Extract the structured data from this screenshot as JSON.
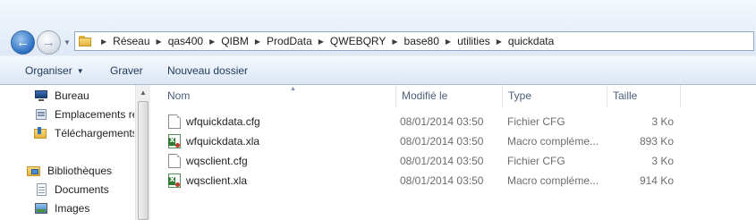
{
  "address_bar": {
    "breadcrumbs": [
      "Réseau",
      "qas400",
      "QIBM",
      "ProdData",
      "QWEBQRY",
      "base80",
      "utilities",
      "quickdata"
    ]
  },
  "toolbar": {
    "organize_label": "Organiser",
    "burn_label": "Graver",
    "new_folder_label": "Nouveau dossier"
  },
  "nav_pane": {
    "items": [
      {
        "label": "Bureau",
        "icon": "desktop-icon"
      },
      {
        "label": "Emplacements ré",
        "icon": "recent-places-icon"
      },
      {
        "label": "Téléchargements",
        "icon": "downloads-icon"
      },
      {
        "label": "Bibliothèques",
        "icon": "libraries-icon"
      },
      {
        "label": "Documents",
        "icon": "documents-icon"
      },
      {
        "label": "Images",
        "icon": "images-icon"
      }
    ]
  },
  "file_list": {
    "columns": {
      "name": "Nom",
      "modified": "Modifié le",
      "type": "Type",
      "size": "Taille"
    },
    "rows": [
      {
        "name": "wfquickdata.cfg",
        "modified": "08/01/2014 03:50",
        "type": "Fichier CFG",
        "size": "3 Ko",
        "icon": "cfg-file-icon"
      },
      {
        "name": "wfquickdata.xla",
        "modified": "08/01/2014 03:50",
        "type": "Macro compléme...",
        "size": "893 Ko",
        "icon": "excel-addin-icon"
      },
      {
        "name": "wqsclient.cfg",
        "modified": "08/01/2014 03:50",
        "type": "Fichier CFG",
        "size": "3 Ko",
        "icon": "cfg-file-icon"
      },
      {
        "name": "wqsclient.xla",
        "modified": "08/01/2014 03:50",
        "type": "Macro compléme...",
        "size": "914 Ko",
        "icon": "excel-addin-icon"
      }
    ]
  }
}
